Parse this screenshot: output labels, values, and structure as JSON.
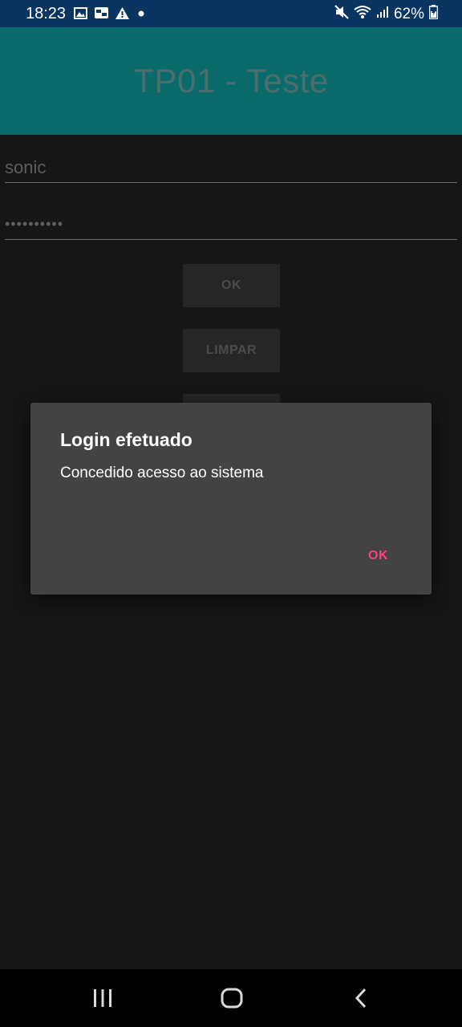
{
  "status_bar": {
    "time": "18:23",
    "battery_percent": "62%",
    "left_icons": [
      "image-icon",
      "notification-icon",
      "warning-icon",
      "dot-icon"
    ],
    "right_icons": [
      "mute-icon",
      "wifi-icon",
      "signal-icon",
      "battery-icon"
    ]
  },
  "app_bar": {
    "title": "TP01 - Teste"
  },
  "form": {
    "username_value": "sonic",
    "password_value": "••••••••••",
    "ok_button_label": "OK",
    "clear_button_label": "LIMPAR"
  },
  "dialog": {
    "title": "Login efetuado",
    "message": "Concedido acesso ao sistema",
    "ok_label": "OK"
  },
  "nav_bar": {
    "icons": [
      "recent-apps-icon",
      "home-icon",
      "back-icon"
    ]
  },
  "colors": {
    "status_bar": "#0a3560",
    "app_bar": "#0a6b6a",
    "background": "#161616",
    "dialog": "#434343",
    "dialog_accent": "#ff3f80"
  }
}
